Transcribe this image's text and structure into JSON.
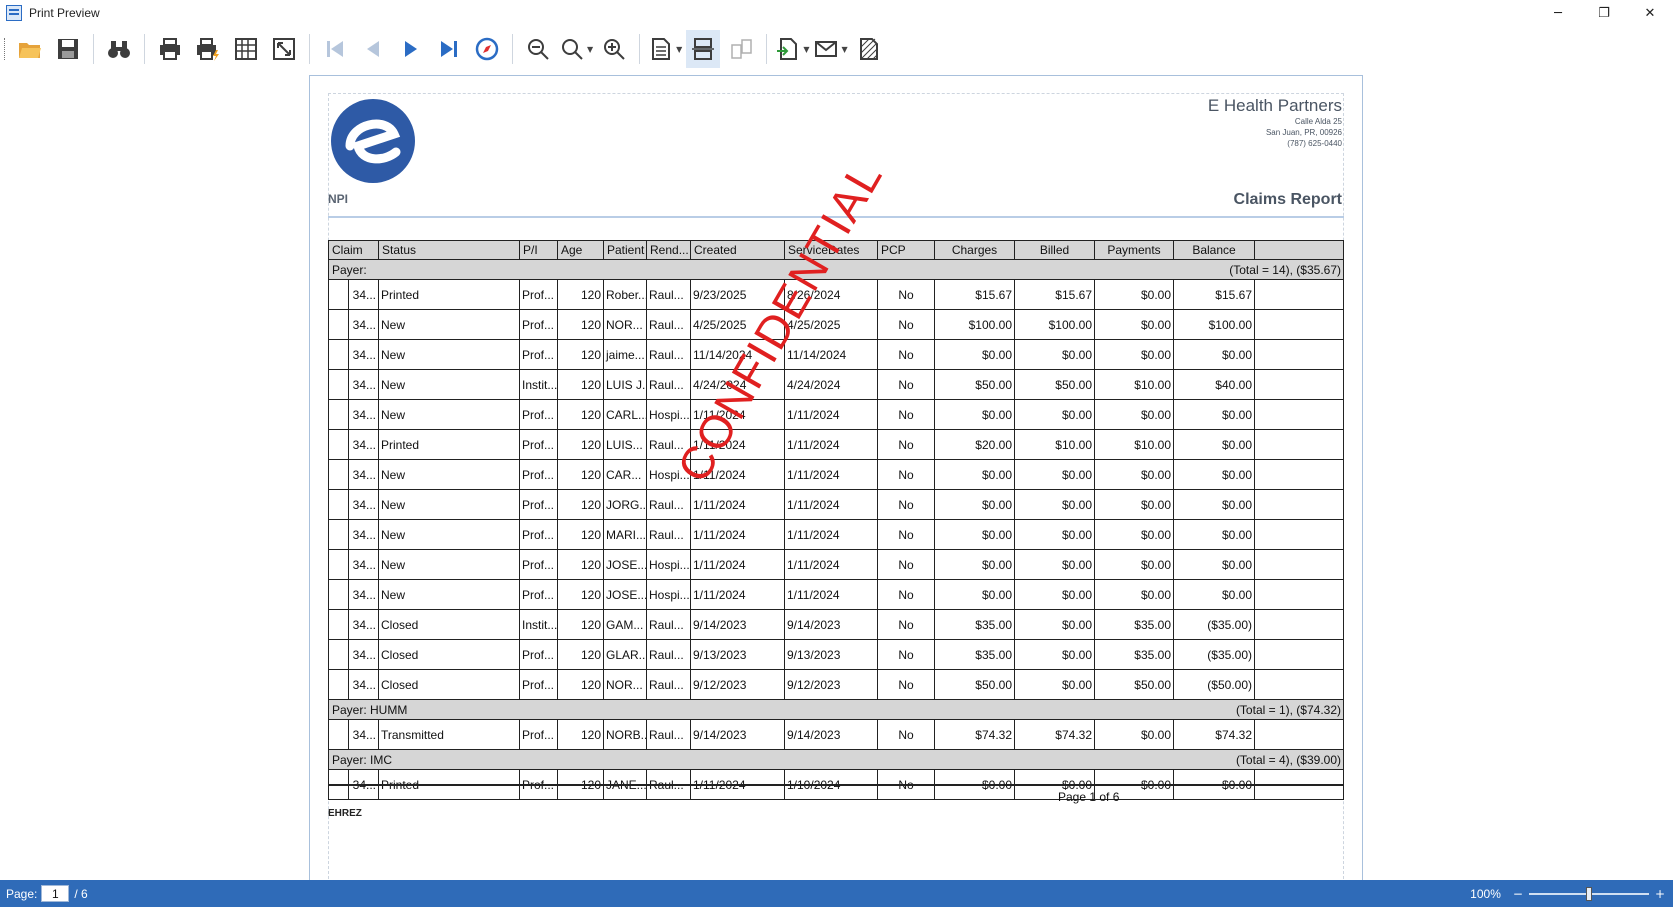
{
  "window": {
    "title": "Print Preview"
  },
  "toolbar": {
    "buttons": [
      {
        "name": "open-button",
        "icon": "folder-icon"
      },
      {
        "name": "save-button",
        "icon": "floppy-icon"
      },
      {
        "name": "find-button",
        "icon": "binoculars-icon"
      },
      {
        "name": "print-button",
        "icon": "printer-icon"
      },
      {
        "name": "quick-print-button",
        "icon": "quick-printer-icon"
      },
      {
        "name": "page-setup-button",
        "icon": "grid-icon"
      },
      {
        "name": "scale-button",
        "icon": "resize-icon"
      },
      {
        "name": "first-page-button",
        "icon": "first-page-icon"
      },
      {
        "name": "previous-page-button",
        "icon": "previous-page-icon"
      },
      {
        "name": "next-page-button",
        "icon": "next-page-icon"
      },
      {
        "name": "last-page-button",
        "icon": "last-page-icon"
      },
      {
        "name": "navigation-button",
        "icon": "compass-icon"
      },
      {
        "name": "zoom-out-button",
        "icon": "zoom-out-icon"
      },
      {
        "name": "zoom-button",
        "icon": "magnifier-icon"
      },
      {
        "name": "zoom-in-button",
        "icon": "zoom-in-icon"
      },
      {
        "name": "page-layout-button",
        "icon": "document-icon"
      },
      {
        "name": "continuous-view-button",
        "icon": "continuous-page-icon"
      },
      {
        "name": "multiple-pages-button",
        "icon": "multiple-pages-icon"
      },
      {
        "name": "export-button",
        "icon": "export-document-icon"
      },
      {
        "name": "send-email-button",
        "icon": "envelope-icon"
      },
      {
        "name": "watermark-button",
        "icon": "watermark-icon"
      }
    ]
  },
  "report": {
    "company_name": "E Health Partners",
    "address_line1": "Calle Alda 25",
    "address_line2": "San Juan, PR, 00926",
    "phone": "(787) 625-0440",
    "npi_label": "NPI",
    "title": "Claims Report",
    "watermark": "CONFIDENTIAL",
    "columns": [
      "Claim",
      "Status",
      "P/I",
      "Age",
      "Patient",
      "Rend...",
      "Created",
      "ServiceDates",
      "PCP",
      "Charges",
      "Billed",
      "Payments",
      "Balance"
    ],
    "groups": [
      {
        "label": "Payer:",
        "total": "(Total = 14), ($35.67)",
        "rows": [
          [
            "34...",
            "Printed",
            "Prof...",
            "120",
            "Rober...",
            "Raul...",
            "9/23/2025",
            "8/26/2024",
            "No",
            "$15.67",
            "$15.67",
            "$0.00",
            "$15.67"
          ],
          [
            "34...",
            "New",
            "Prof...",
            "120",
            "NOR...",
            "Raul...",
            "4/25/2025",
            "4/25/2025",
            "No",
            "$100.00",
            "$100.00",
            "$0.00",
            "$100.00"
          ],
          [
            "34...",
            "New",
            "Prof...",
            "120",
            "jaime...",
            "Raul...",
            "11/14/2024",
            "11/14/2024",
            "No",
            "$0.00",
            "$0.00",
            "$0.00",
            "$0.00"
          ],
          [
            "34...",
            "New",
            "Instit...",
            "120",
            "LUIS J...",
            "Raul...",
            "4/24/2024",
            "4/24/2024",
            "No",
            "$50.00",
            "$50.00",
            "$10.00",
            "$40.00"
          ],
          [
            "34...",
            "New",
            "Prof...",
            "120",
            "CARL...",
            "Hospi...",
            "1/11/2024",
            "1/11/2024",
            "No",
            "$0.00",
            "$0.00",
            "$0.00",
            "$0.00"
          ],
          [
            "34...",
            "Printed",
            "Prof...",
            "120",
            "LUIS...",
            "Raul...",
            "1/11/2024",
            "1/11/2024",
            "No",
            "$20.00",
            "$10.00",
            "$10.00",
            "$0.00"
          ],
          [
            "34...",
            "New",
            "Prof...",
            "120",
            "CAR...",
            "Hospi...",
            "1/11/2024",
            "1/11/2024",
            "No",
            "$0.00",
            "$0.00",
            "$0.00",
            "$0.00"
          ],
          [
            "34...",
            "New",
            "Prof...",
            "120",
            "JORG...",
            "Raul...",
            "1/11/2024",
            "1/11/2024",
            "No",
            "$0.00",
            "$0.00",
            "$0.00",
            "$0.00"
          ],
          [
            "34...",
            "New",
            "Prof...",
            "120",
            "MARI...",
            "Raul...",
            "1/11/2024",
            "1/11/2024",
            "No",
            "$0.00",
            "$0.00",
            "$0.00",
            "$0.00"
          ],
          [
            "34...",
            "New",
            "Prof...",
            "120",
            "JOSE...",
            "Hospi...",
            "1/11/2024",
            "1/11/2024",
            "No",
            "$0.00",
            "$0.00",
            "$0.00",
            "$0.00"
          ],
          [
            "34...",
            "New",
            "Prof...",
            "120",
            "JOSE...",
            "Hospi...",
            "1/11/2024",
            "1/11/2024",
            "No",
            "$0.00",
            "$0.00",
            "$0.00",
            "$0.00"
          ],
          [
            "34...",
            "Closed",
            "Instit...",
            "120",
            "GAM...",
            "Raul...",
            "9/14/2023",
            "9/14/2023",
            "No",
            "$35.00",
            "$0.00",
            "$35.00",
            "($35.00)"
          ],
          [
            "34...",
            "Closed",
            "Prof...",
            "120",
            "GLAR...",
            "Raul...",
            "9/13/2023",
            "9/13/2023",
            "No",
            "$35.00",
            "$0.00",
            "$35.00",
            "($35.00)"
          ],
          [
            "34...",
            "Closed",
            "Prof...",
            "120",
            "NOR...",
            "Raul...",
            "9/12/2023",
            "9/12/2023",
            "No",
            "$50.00",
            "$0.00",
            "$50.00",
            "($50.00)"
          ]
        ]
      },
      {
        "label": "Payer: HUMM",
        "total": "(Total = 1), ($74.32)",
        "rows": [
          [
            "34...",
            "Transmitted",
            "Prof...",
            "120",
            "NORB...",
            "Raul...",
            "9/14/2023",
            "9/14/2023",
            "No",
            "$74.32",
            "$74.32",
            "$0.00",
            "$74.32"
          ]
        ]
      },
      {
        "label": "Payer: IMC",
        "total": "(Total = 4), ($39.00)",
        "rows": [
          [
            "34...",
            "Printed",
            "Prof...",
            "120",
            "JANE...",
            "Raul...",
            "1/11/2024",
            "1/10/2024",
            "No",
            "$0.00",
            "$0.00",
            "$0.00",
            "$0.00"
          ]
        ]
      }
    ],
    "page_number_text": "Page 1 of 6",
    "footer_user": "EHREZ"
  },
  "statusbar": {
    "page_label": "Page:",
    "current_page": "1",
    "total_pages": "/ 6",
    "zoom": "100%",
    "zoom_minus": "−",
    "zoom_plus": "+",
    "zoom_level": 0.5
  },
  "colors": {
    "accent": "#2f6bb8",
    "watermark": "#e02020",
    "logo": "#2e5aa6"
  }
}
